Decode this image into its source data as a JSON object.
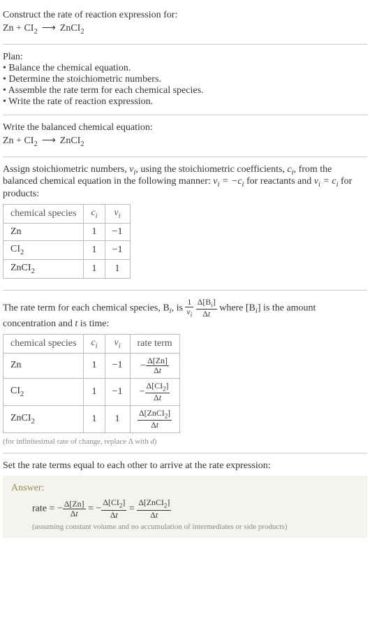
{
  "header": {
    "prompt": "Construct the rate of reaction expression for:",
    "equation": "Zn + CI₂  ⟶  ZnCI₂"
  },
  "plan": {
    "title": "Plan:",
    "items": [
      "Balance the chemical equation.",
      "Determine the stoichiometric numbers.",
      "Assemble the rate term for each chemical species.",
      "Write the rate of reaction expression."
    ]
  },
  "balanced": {
    "title": "Write the balanced chemical equation:",
    "equation": "Zn + CI₂  ⟶  ZnCI₂"
  },
  "stoich": {
    "intro_a": "Assign stoichiometric numbers, ",
    "nu_i": "νᵢ",
    "intro_b": ", using the stoichiometric coefficients, ",
    "c_i": "cᵢ",
    "intro_c": ", from the balanced chemical equation in the following manner: ",
    "rel_react": "νᵢ = −cᵢ",
    "for_react": " for reactants and ",
    "rel_prod": "νᵢ = cᵢ",
    "for_prod": " for products:",
    "headers": {
      "species": "chemical species",
      "ci": "cᵢ",
      "nui": "νᵢ"
    },
    "rows": [
      {
        "species": "Zn",
        "ci": "1",
        "nui": "−1"
      },
      {
        "species": "CI₂",
        "ci": "1",
        "nui": "−1"
      },
      {
        "species": "ZnCI₂",
        "ci": "1",
        "nui": "1"
      }
    ]
  },
  "rateterm": {
    "intro_a": "The rate term for each chemical species, B",
    "intro_b": ", is ",
    "explain_a": " where [B",
    "explain_b": "] is the amount concentration and ",
    "explain_c": " is time:",
    "headers": {
      "species": "chemical species",
      "ci": "cᵢ",
      "nui": "νᵢ",
      "rate": "rate term"
    },
    "rows": [
      {
        "species": "Zn",
        "ci": "1",
        "nui": "−1",
        "num": "Δ[Zn]",
        "den": "Δt",
        "sign": "−"
      },
      {
        "species": "CI₂",
        "ci": "1",
        "nui": "−1",
        "num": "Δ[CI₂]",
        "den": "Δt",
        "sign": "−"
      },
      {
        "species": "ZnCI₂",
        "ci": "1",
        "nui": "1",
        "num": "Δ[ZnCI₂]",
        "den": "Δt",
        "sign": ""
      }
    ],
    "note": "(for infinitesimal rate of change, replace Δ with d)"
  },
  "final": {
    "title": "Set the rate terms equal to each other to arrive at the rate expression:",
    "answer_label": "Answer:",
    "rate_label": "rate = ",
    "terms": [
      {
        "sign": "−",
        "num": "Δ[Zn]",
        "den": "Δt"
      },
      {
        "sign": "−",
        "num": "Δ[CI₂]",
        "den": "Δt"
      },
      {
        "sign": "",
        "num": "Δ[ZnCI₂]",
        "den": "Δt"
      }
    ],
    "note": "(assuming constant volume and no accumulation of intermediates or side products)"
  },
  "chart_data": {
    "type": "table",
    "tables": [
      {
        "title": "stoichiometric numbers",
        "columns": [
          "chemical species",
          "c_i",
          "nu_i"
        ],
        "rows": [
          [
            "Zn",
            1,
            -1
          ],
          [
            "CI2",
            1,
            -1
          ],
          [
            "ZnCI2",
            1,
            1
          ]
        ]
      },
      {
        "title": "rate terms",
        "columns": [
          "chemical species",
          "c_i",
          "nu_i",
          "rate term"
        ],
        "rows": [
          [
            "Zn",
            1,
            -1,
            "-Δ[Zn]/Δt"
          ],
          [
            "CI2",
            1,
            -1,
            "-Δ[CI2]/Δt"
          ],
          [
            "ZnCI2",
            1,
            1,
            "Δ[ZnCI2]/Δt"
          ]
        ]
      }
    ],
    "rate_expression": "rate = -Δ[Zn]/Δt = -Δ[CI2]/Δt = Δ[ZnCI2]/Δt"
  }
}
